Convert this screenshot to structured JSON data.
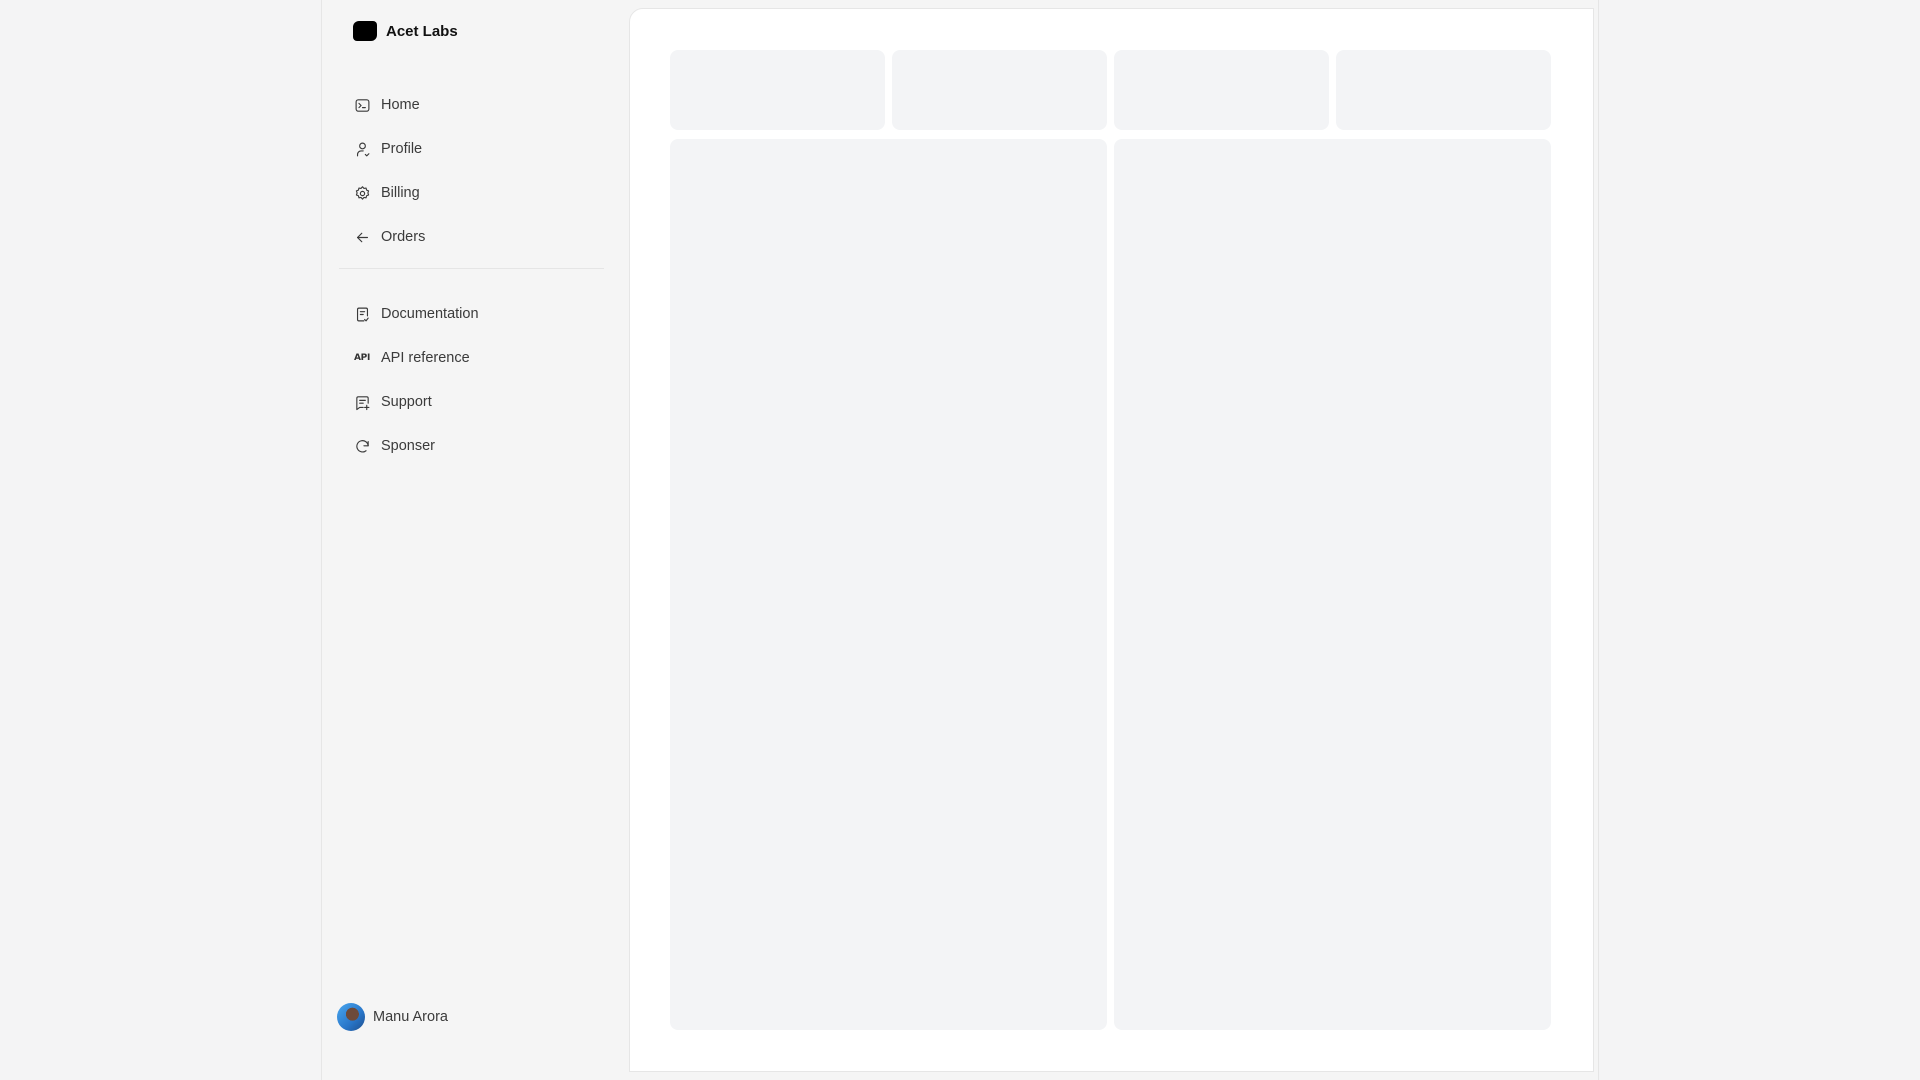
{
  "brand": {
    "name": "Acet Labs"
  },
  "sidebar": {
    "primary_items": [
      {
        "label": "Home",
        "icon": "terminal-icon"
      },
      {
        "label": "Profile",
        "icon": "user-icon"
      },
      {
        "label": "Billing",
        "icon": "gear-icon"
      },
      {
        "label": "Orders",
        "icon": "arrow-left-icon"
      }
    ],
    "secondary_items": [
      {
        "label": "Documentation",
        "icon": "document-check-icon"
      },
      {
        "label": "API reference",
        "icon": "api-icon",
        "icon_text": "API"
      },
      {
        "label": "Support",
        "icon": "message-plus-icon"
      },
      {
        "label": "Sponser",
        "icon": "refresh-icon"
      }
    ]
  },
  "user": {
    "name": "Manu Arora"
  },
  "colors": {
    "page_background": "#f5f5f5",
    "panel_background": "#ffffff",
    "skeleton": "#f3f4f6",
    "text": "#3b3b3b"
  }
}
